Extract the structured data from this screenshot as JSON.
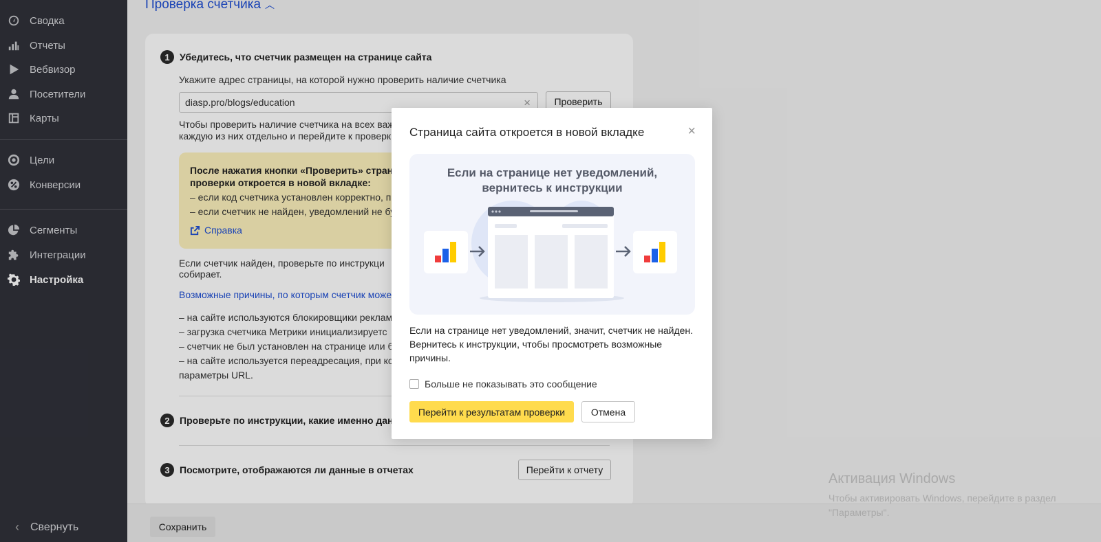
{
  "sidebar": {
    "items": [
      {
        "label": "Сводка",
        "icon": "gauge-icon"
      },
      {
        "label": "Отчеты",
        "icon": "bar-chart-icon"
      },
      {
        "label": "Вебвизор",
        "icon": "play-icon"
      },
      {
        "label": "Посетители",
        "icon": "user-icon"
      },
      {
        "label": "Карты",
        "icon": "map-layout-icon"
      },
      {
        "label": "Цели",
        "icon": "target-icon"
      },
      {
        "label": "Конверсии",
        "icon": "percent-icon"
      },
      {
        "label": "Сегменты",
        "icon": "pie-chart-icon"
      },
      {
        "label": "Интеграции",
        "icon": "puzzle-icon"
      },
      {
        "label": "Настройка",
        "icon": "gear-icon",
        "active": true
      }
    ],
    "collapse_label": "Свернуть"
  },
  "main": {
    "title": "Проверка счетчика",
    "step1": {
      "number": "1",
      "title": "Убедитесь, что счетчик размещен на странице сайта",
      "hint": "Укажите адрес страницы, на которой нужно проверить наличие счетчика",
      "url_value": "diasp.pro/blogs/education",
      "check_button": "Проверить",
      "multi_line1": "Чтобы проверить наличие счетчика на всех важ",
      "multi_line2": "каждую из них отдельно и перейдите к проверк",
      "notice_title_line1": "После нажатия кнопки «Проверить» страни",
      "notice_title_line2": "проверки откроется в новой вкладке:",
      "notice_item1": "– если код счетчика установлен корректно, п",
      "notice_item2": "– если счетчик не найден, уведомлений не бу",
      "help_link": "Справка",
      "found_line1": "Если счетчик найден, проверьте по инструкци",
      "found_line2": "собирает.",
      "reasons_link": "Возможные причины, по которым счетчик може",
      "reasons": [
        "– на сайте используются блокировщики реклам",
        "– загрузка счетчика Метрики инициализируетс",
        "– счетчик не был установлен на странице или бы",
        "– на сайте используется переадресация, при ко",
        "параметры URL."
      ]
    },
    "step2": {
      "number": "2",
      "title": "Проверьте по инструкции, какие именно данн"
    },
    "step3": {
      "number": "3",
      "title": "Посмотрите, отображаются ли данные в отчетах",
      "button": "Перейти к отчету"
    },
    "save_button": "Сохранить"
  },
  "dialog": {
    "title": "Страница сайта откроется в новой вкладке",
    "illustration_line1": "Если на странице нет уведомлений,",
    "illustration_line2": "вернитесь к инструкции",
    "description": "Если на странице нет уведомлений, значит, счетчик не найден. Вернитесь к инструкции, чтобы просмотреть возможные причины.",
    "checkbox_label": "Больше не показывать это сообщение",
    "checkbox_checked": false,
    "primary_button": "Перейти к результатам проверки",
    "cancel_button": "Отмена"
  },
  "watermark": {
    "title": "Активация Windows",
    "subtitle": "Чтобы активировать Windows, перейдите в раздел \"Параметры\"."
  },
  "colors": {
    "sidebar_bg": "#30313a",
    "link": "#1f4fd3",
    "accent_yellow": "#ffdb4d",
    "notice_bg": "#fdf1bd"
  }
}
